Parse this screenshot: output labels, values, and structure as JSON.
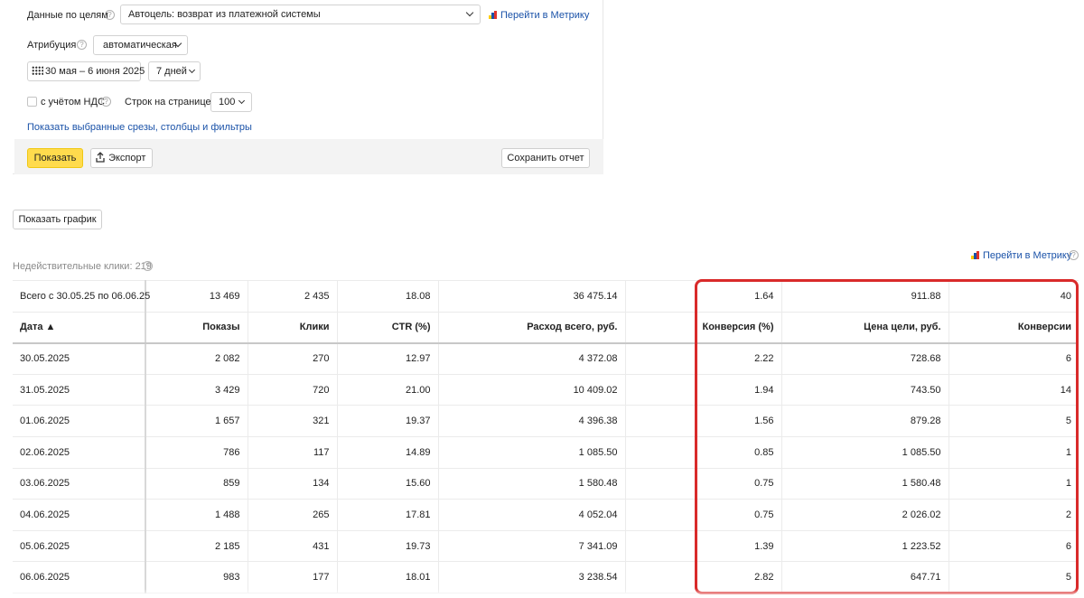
{
  "filters": {
    "goals_label": "Данные по целям",
    "goal_value": "Автоцель: возврат из платежной системы",
    "metrika_link": "Перейти в Метрику",
    "attribution_label": "Атрибуция",
    "attribution_value": "автоматическая",
    "date_range": "30 мая – 6 июня 2025",
    "period_value": "7 дней",
    "vat_label": "с учётом НДС",
    "rows_label": "Строк на странице",
    "rows_value": "100",
    "show_selected_link": "Показать выбранные срезы, столбцы и фильтры"
  },
  "actions": {
    "show_button": "Показать",
    "export_button": "Экспорт",
    "save_report_button": "Сохранить отчет",
    "show_chart_button": "Показать график"
  },
  "report": {
    "invalid_clicks": "Недействительные клики: 219",
    "metrika_link": "Перейти в Метрику",
    "totals": [
      "Всего с 30.05.25 по 06.06.25",
      "13 469",
      "2 435",
      "18.08",
      "36 475.14",
      "1.64",
      "911.88",
      "40"
    ],
    "columns": [
      "Дата ▲",
      "Показы",
      "Клики",
      "CTR (%)",
      "Расход всего, руб.",
      "Конверсия (%)",
      "Цена цели, руб.",
      "Конверсии"
    ],
    "rows": [
      [
        "30.05.2025",
        "2 082",
        "270",
        "12.97",
        "4 372.08",
        "2.22",
        "728.68",
        "6"
      ],
      [
        "31.05.2025",
        "3 429",
        "720",
        "21.00",
        "10 409.02",
        "1.94",
        "743.50",
        "14"
      ],
      [
        "01.06.2025",
        "1 657",
        "321",
        "19.37",
        "4 396.38",
        "1.56",
        "879.28",
        "5"
      ],
      [
        "02.06.2025",
        "786",
        "117",
        "14.89",
        "1 085.50",
        "0.85",
        "1 085.50",
        "1"
      ],
      [
        "03.06.2025",
        "859",
        "134",
        "15.60",
        "1 580.48",
        "0.75",
        "1 580.48",
        "1"
      ],
      [
        "04.06.2025",
        "1 488",
        "265",
        "17.81",
        "4 052.04",
        "0.75",
        "2 026.02",
        "2"
      ],
      [
        "05.06.2025",
        "2 185",
        "431",
        "19.73",
        "7 341.09",
        "1.39",
        "1 223.52",
        "6"
      ],
      [
        "06.06.2025",
        "983",
        "177",
        "18.01",
        "3 238.54",
        "2.82",
        "647.71",
        "5"
      ]
    ]
  },
  "colors": {
    "accent_yellow": "#ffdb4d",
    "link_blue": "#1a52a8",
    "highlight_red": "#d92a2a"
  },
  "icons": {
    "help": "question-circle-icon",
    "calendar": "calendar-icon",
    "export": "upload-icon",
    "metrika": "metrika-logo-icon",
    "sort": "sort-ascending-icon"
  }
}
